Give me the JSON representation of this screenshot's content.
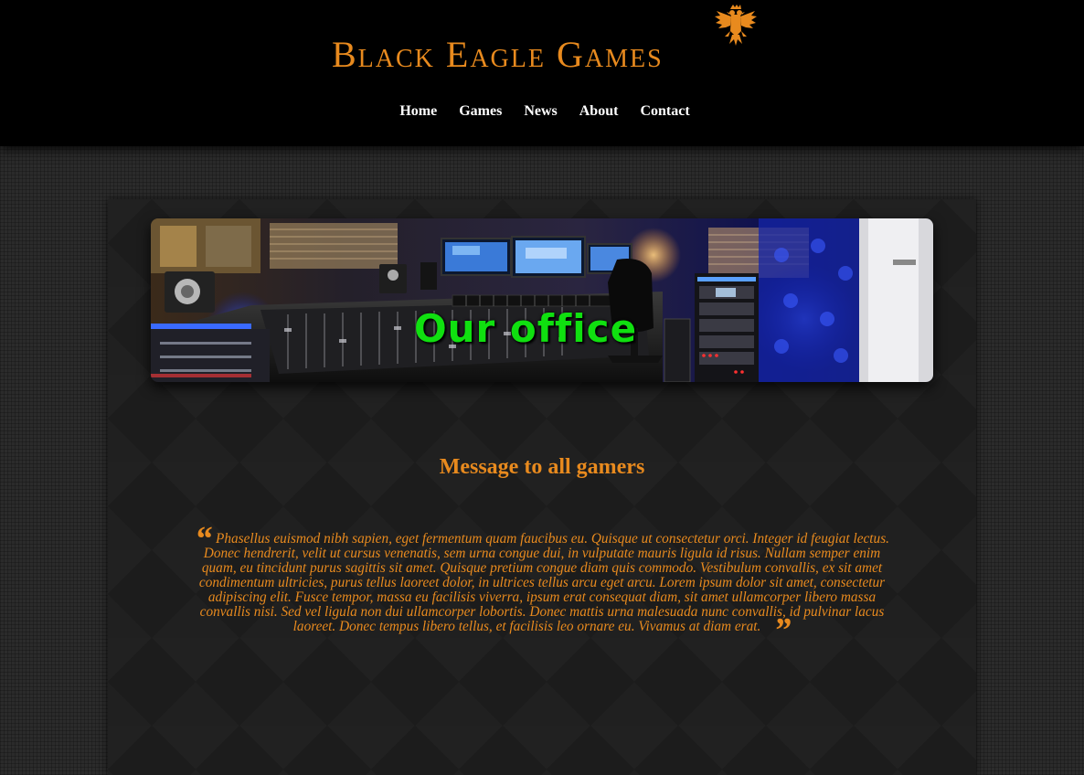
{
  "header": {
    "logo_text": "Black Eagle Games",
    "logo_icon": "eagle-icon",
    "nav": [
      {
        "label": "Home"
      },
      {
        "label": "Games"
      },
      {
        "label": "News"
      },
      {
        "label": "About"
      },
      {
        "label": "Contact"
      }
    ]
  },
  "banner": {
    "caption": "Our office",
    "image": "recording-studio-photo"
  },
  "message": {
    "title": "Message to all gamers",
    "open_quote": "“",
    "close_quote": "”",
    "body": "Phasellus euismod nibh sapien, eget fermentum quam faucibus eu. Quisque ut consectetur orci. Integer id feugiat lectus. Donec hendrerit, velit ut cursus venenatis, sem urna congue dui, in vulputate mauris ligula id risus. Nullam semper enim quam, eu tincidunt purus sagittis sit amet. Quisque pretium congue diam quis commodo. Vestibulum convallis, ex sit amet condimentum ultricies, purus tellus laoreet dolor, in ultrices tellus arcu eget arcu. Lorem ipsum dolor sit amet, consectetur adipiscing elit. Fusce tempor, massa eu facilisis viverra, ipsum erat consequat diam, sit amet ullamcorper libero massa convallis nisi. Sed vel ligula non dui ullamcorper lobortis. Donec mattis urna malesuada nunc convallis, id pulvinar lacus laoreet. Donec tempus libero tellus, et facilisis leo ornare eu. Vivamus at diam erat."
  },
  "colors": {
    "accent": "#e88a1e",
    "banner_caption": "#10e010",
    "header_bg": "#000000",
    "nav_text": "#ffffff"
  }
}
